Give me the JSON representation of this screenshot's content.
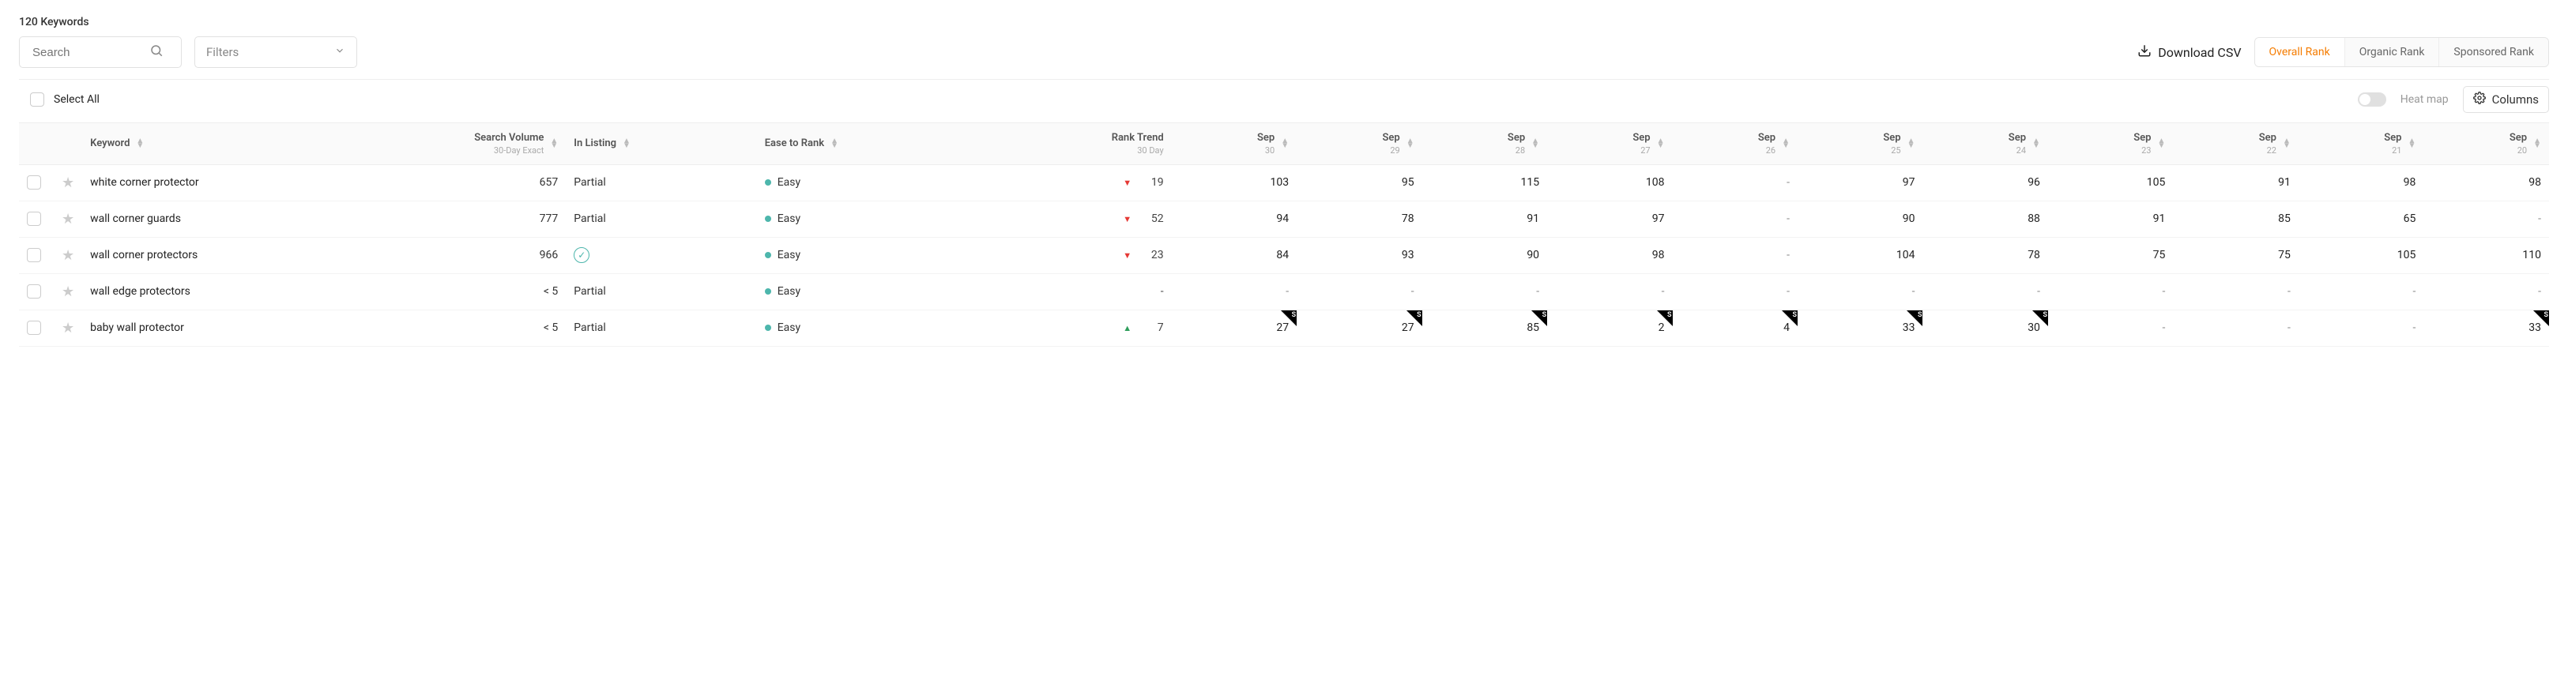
{
  "title": "120 Keywords",
  "search": {
    "placeholder": "Search"
  },
  "filters": {
    "label": "Filters"
  },
  "download_label": "Download CSV",
  "rank_tabs": {
    "active_index": 0,
    "items": [
      "Overall Rank",
      "Organic Rank",
      "Sponsored Rank"
    ]
  },
  "select_all_label": "Select All",
  "heatmap_label": "Heat map",
  "columns_label": "Columns",
  "colors": {
    "easy": "#4db6ac",
    "accent": "#f57c00",
    "highlight": "#e53935"
  },
  "columns": {
    "keyword": "Keyword",
    "search_volume": "Search Volume",
    "search_volume_sub": "30-Day Exact",
    "in_listing": "In Listing",
    "ease_to_rank": "Ease to Rank",
    "rank_trend": "Rank Trend",
    "rank_trend_sub": "30 Day",
    "dates": [
      "Sep 30",
      "Sep 29",
      "Sep 28",
      "Sep 27",
      "Sep 26",
      "Sep 25",
      "Sep 24",
      "Sep 23",
      "Sep 22",
      "Sep 21",
      "Sep 20"
    ]
  },
  "rows": [
    {
      "keyword": "white corner protector",
      "search_volume": "657",
      "in_listing": "Partial",
      "in_listing_check": false,
      "ease": "Easy",
      "trend_dir": "down",
      "trend_val": "19",
      "ranks": [
        {
          "v": "103"
        },
        {
          "v": "95"
        },
        {
          "v": "115"
        },
        {
          "v": "108"
        },
        {
          "v": "-"
        },
        {
          "v": "97"
        },
        {
          "v": "96"
        },
        {
          "v": "105"
        },
        {
          "v": "91"
        },
        {
          "v": "98"
        },
        {
          "v": "98"
        }
      ]
    },
    {
      "keyword": "wall corner guards",
      "search_volume": "777",
      "in_listing": "Partial",
      "in_listing_check": false,
      "ease": "Easy",
      "trend_dir": "down",
      "trend_val": "52",
      "ranks": [
        {
          "v": "94"
        },
        {
          "v": "78"
        },
        {
          "v": "91"
        },
        {
          "v": "97"
        },
        {
          "v": "-"
        },
        {
          "v": "90"
        },
        {
          "v": "88"
        },
        {
          "v": "91"
        },
        {
          "v": "85"
        },
        {
          "v": "65"
        },
        {
          "v": "-"
        }
      ]
    },
    {
      "keyword": "wall corner protectors",
      "search_volume": "966",
      "in_listing": "",
      "in_listing_check": true,
      "ease": "Easy",
      "trend_dir": "down",
      "trend_val": "23",
      "ranks": [
        {
          "v": "84"
        },
        {
          "v": "93"
        },
        {
          "v": "90"
        },
        {
          "v": "98"
        },
        {
          "v": "-"
        },
        {
          "v": "104"
        },
        {
          "v": "78"
        },
        {
          "v": "75"
        },
        {
          "v": "75"
        },
        {
          "v": "105"
        },
        {
          "v": "110"
        }
      ]
    },
    {
      "keyword": "wall edge protectors",
      "search_volume": "< 5",
      "in_listing": "Partial",
      "in_listing_check": false,
      "ease": "Easy",
      "trend_dir": "",
      "trend_val": "-",
      "ranks": [
        {
          "v": "-"
        },
        {
          "v": "-"
        },
        {
          "v": "-"
        },
        {
          "v": "-"
        },
        {
          "v": "-"
        },
        {
          "v": "-"
        },
        {
          "v": "-"
        },
        {
          "v": "-"
        },
        {
          "v": "-"
        },
        {
          "v": "-"
        },
        {
          "v": "-"
        }
      ]
    },
    {
      "keyword": "baby wall protector",
      "search_volume": "< 5",
      "in_listing": "Partial",
      "in_listing_check": false,
      "ease": "Easy",
      "trend_dir": "up",
      "trend_val": "7",
      "ranks": [
        {
          "v": "27",
          "s": true
        },
        {
          "v": "27",
          "s": true
        },
        {
          "v": "85",
          "s": true
        },
        {
          "v": "2",
          "s": true
        },
        {
          "v": "4",
          "s": true
        },
        {
          "v": "33",
          "s": true
        },
        {
          "v": "30",
          "s": true
        },
        {
          "v": "-"
        },
        {
          "v": "-"
        },
        {
          "v": "-"
        },
        {
          "v": "33",
          "s": true
        }
      ]
    }
  ]
}
